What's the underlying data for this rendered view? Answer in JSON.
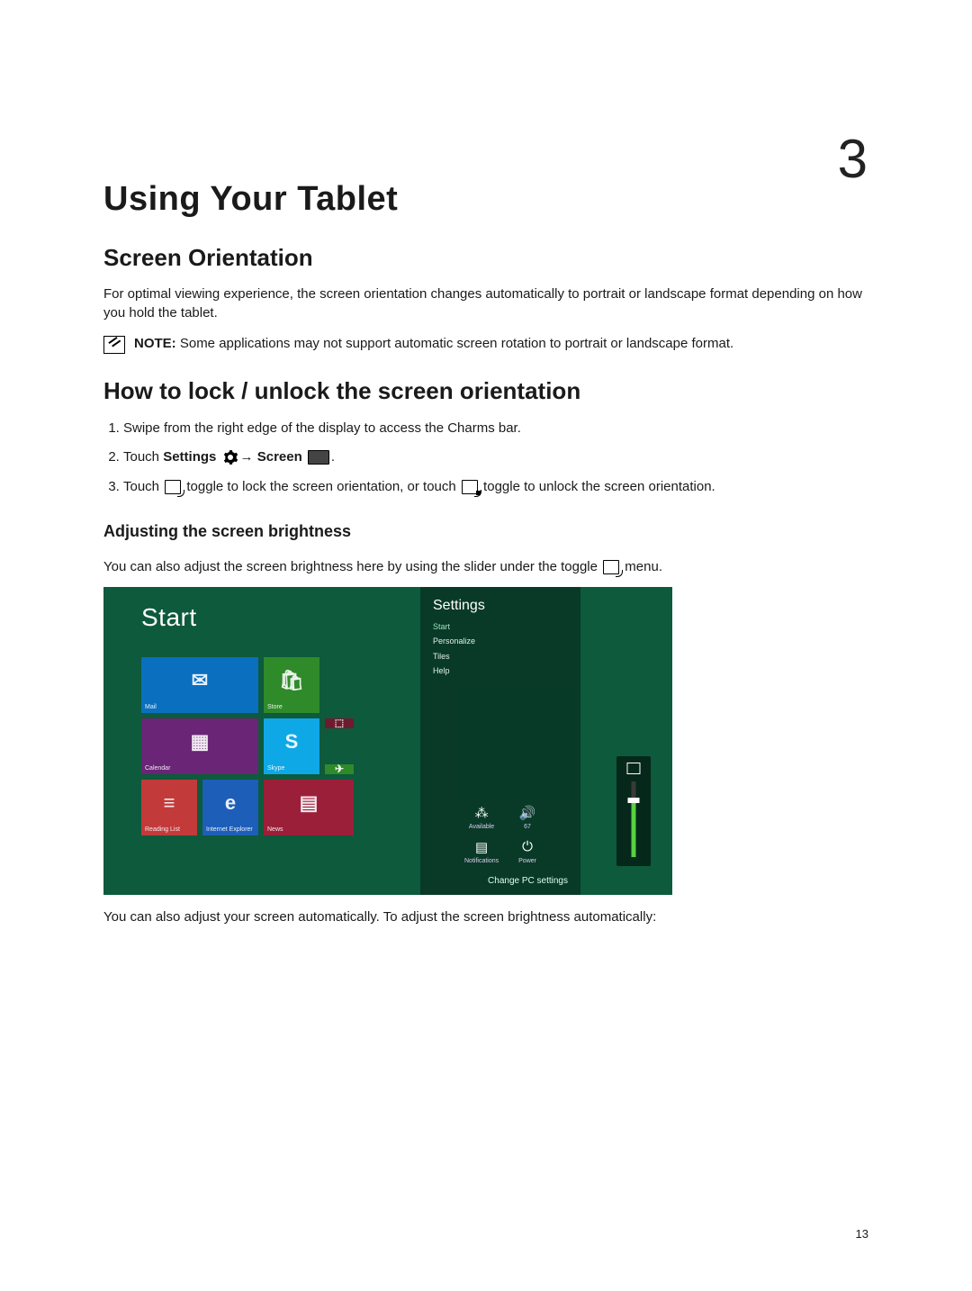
{
  "chapter_number": "3",
  "chapter_title": "Using Your Tablet",
  "page_number": "13",
  "section1": {
    "heading": "Screen Orientation",
    "body": "For optimal viewing experience, the screen orientation changes automatically to portrait or landscape format depending on how you hold the tablet.",
    "note_label": "NOTE: ",
    "note_body": "Some applications may not support automatic screen rotation to portrait or landscape format."
  },
  "section2": {
    "heading": "How to lock / unlock the screen orientation",
    "step1": "Swipe from the right edge of the display to access the Charms bar.",
    "step2_a": "Touch ",
    "step2_b": "Settings ",
    "step2_c": "→ ",
    "step2_d": "Screen ",
    "step2_e": ".",
    "step3_a": "Touch ",
    "step3_b": " toggle to lock the screen orientation, or touch ",
    "step3_c": " toggle to unlock the screen orientation."
  },
  "section3": {
    "heading": "Adjusting the screen brightness",
    "body1_a": "You can also adjust the screen brightness here by using the slider under the toggle ",
    "body1_b": " menu.",
    "body2": "You can also adjust your screen automatically. To adjust the screen brightness automatically:"
  },
  "win8": {
    "start": "Start",
    "tiles": {
      "mail": "Mail",
      "store": "Store",
      "calendar": "Calendar",
      "skype": "Skype",
      "reading": "Reading List",
      "ie": "Internet Explorer",
      "news": "News"
    },
    "settings_title": "Settings",
    "menu": [
      "Start",
      "Personalize",
      "Tiles",
      "Help"
    ],
    "bottom": {
      "net": "Available",
      "vol": "67",
      "notif": "Notifications",
      "power": "Power"
    },
    "change_pc": "Change PC settings"
  }
}
